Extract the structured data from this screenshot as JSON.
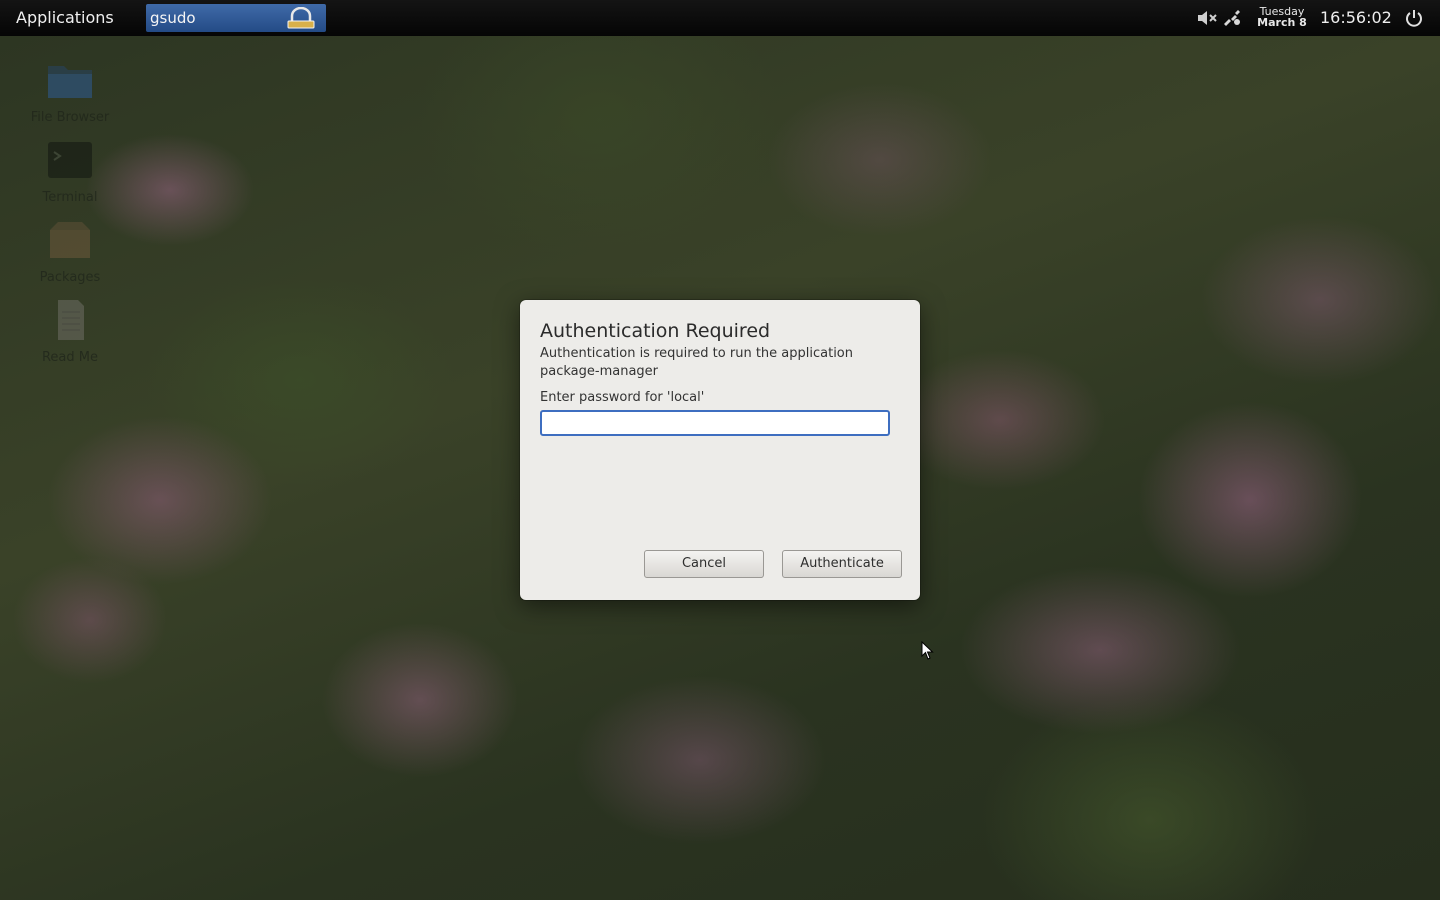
{
  "panel": {
    "applications_label": "Applications",
    "task_label": "gsudo",
    "date_day": "Tuesday",
    "date_month": "March 8",
    "time": "16:56:02",
    "icons": {
      "task": "padlock-icon",
      "volume": "volume-muted-icon",
      "network": "network-icon",
      "power": "power-icon"
    }
  },
  "desktop": {
    "icons": [
      {
        "label": "File Browser",
        "icon": "folder-icon"
      },
      {
        "label": "Terminal",
        "icon": "terminal-icon"
      },
      {
        "label": "Packages",
        "icon": "package-box-icon"
      },
      {
        "label": "Read Me",
        "icon": "document-icon"
      }
    ]
  },
  "dialog": {
    "title": "Authentication Required",
    "message": "Authentication is required to run the application package-manager",
    "password_label": "Enter password for 'local'",
    "password_value": "",
    "cancel_label": "Cancel",
    "authenticate_label": "Authenticate",
    "accent_color": "#3e6ec0"
  }
}
